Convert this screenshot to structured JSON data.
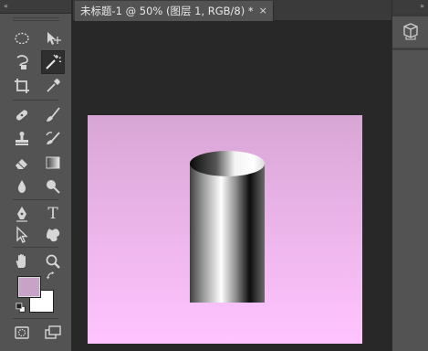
{
  "toolbar": {
    "collapse_glyph": "«",
    "tools": [
      {
        "icon": "elliptical-marquee-icon"
      },
      {
        "icon": "move-icon"
      },
      {
        "icon": "lasso-icon"
      },
      {
        "icon": "magic-wand-icon",
        "active": true
      },
      {
        "icon": "crop-icon"
      },
      {
        "icon": "eyedropper-icon"
      },
      {
        "icon": "spot-healing-brush-icon"
      },
      {
        "icon": "brush-icon"
      },
      {
        "icon": "clone-stamp-icon"
      },
      {
        "icon": "history-brush-icon"
      },
      {
        "icon": "eraser-icon"
      },
      {
        "icon": "gradient-icon"
      },
      {
        "icon": "blur-icon"
      },
      {
        "icon": "dodge-icon"
      },
      {
        "icon": "pen-icon"
      },
      {
        "icon": "type-icon",
        "glyph": "T"
      },
      {
        "icon": "path-selection-icon"
      },
      {
        "icon": "custom-shape-icon"
      },
      {
        "icon": "hand-icon"
      },
      {
        "icon": "zoom-icon"
      },
      {
        "icon": "default-colors-icon"
      },
      {
        "icon": "swap-colors-icon"
      },
      {
        "icon": "quick-mask-icon"
      },
      {
        "icon": "screen-mode-icon"
      }
    ],
    "foreground_color": "#c8a3c8",
    "background_color": "#ffffff"
  },
  "document": {
    "tab_title": "未标题-1 @ 50% (图层 1, RGB/8) *",
    "close_glyph": "×",
    "canvas": {
      "gradient_top": "#d8a6d5",
      "gradient_bottom": "#ffc4ff"
    }
  },
  "right_dock": {
    "collapse_glyph": "»",
    "icon": "3d-cube-icon"
  }
}
